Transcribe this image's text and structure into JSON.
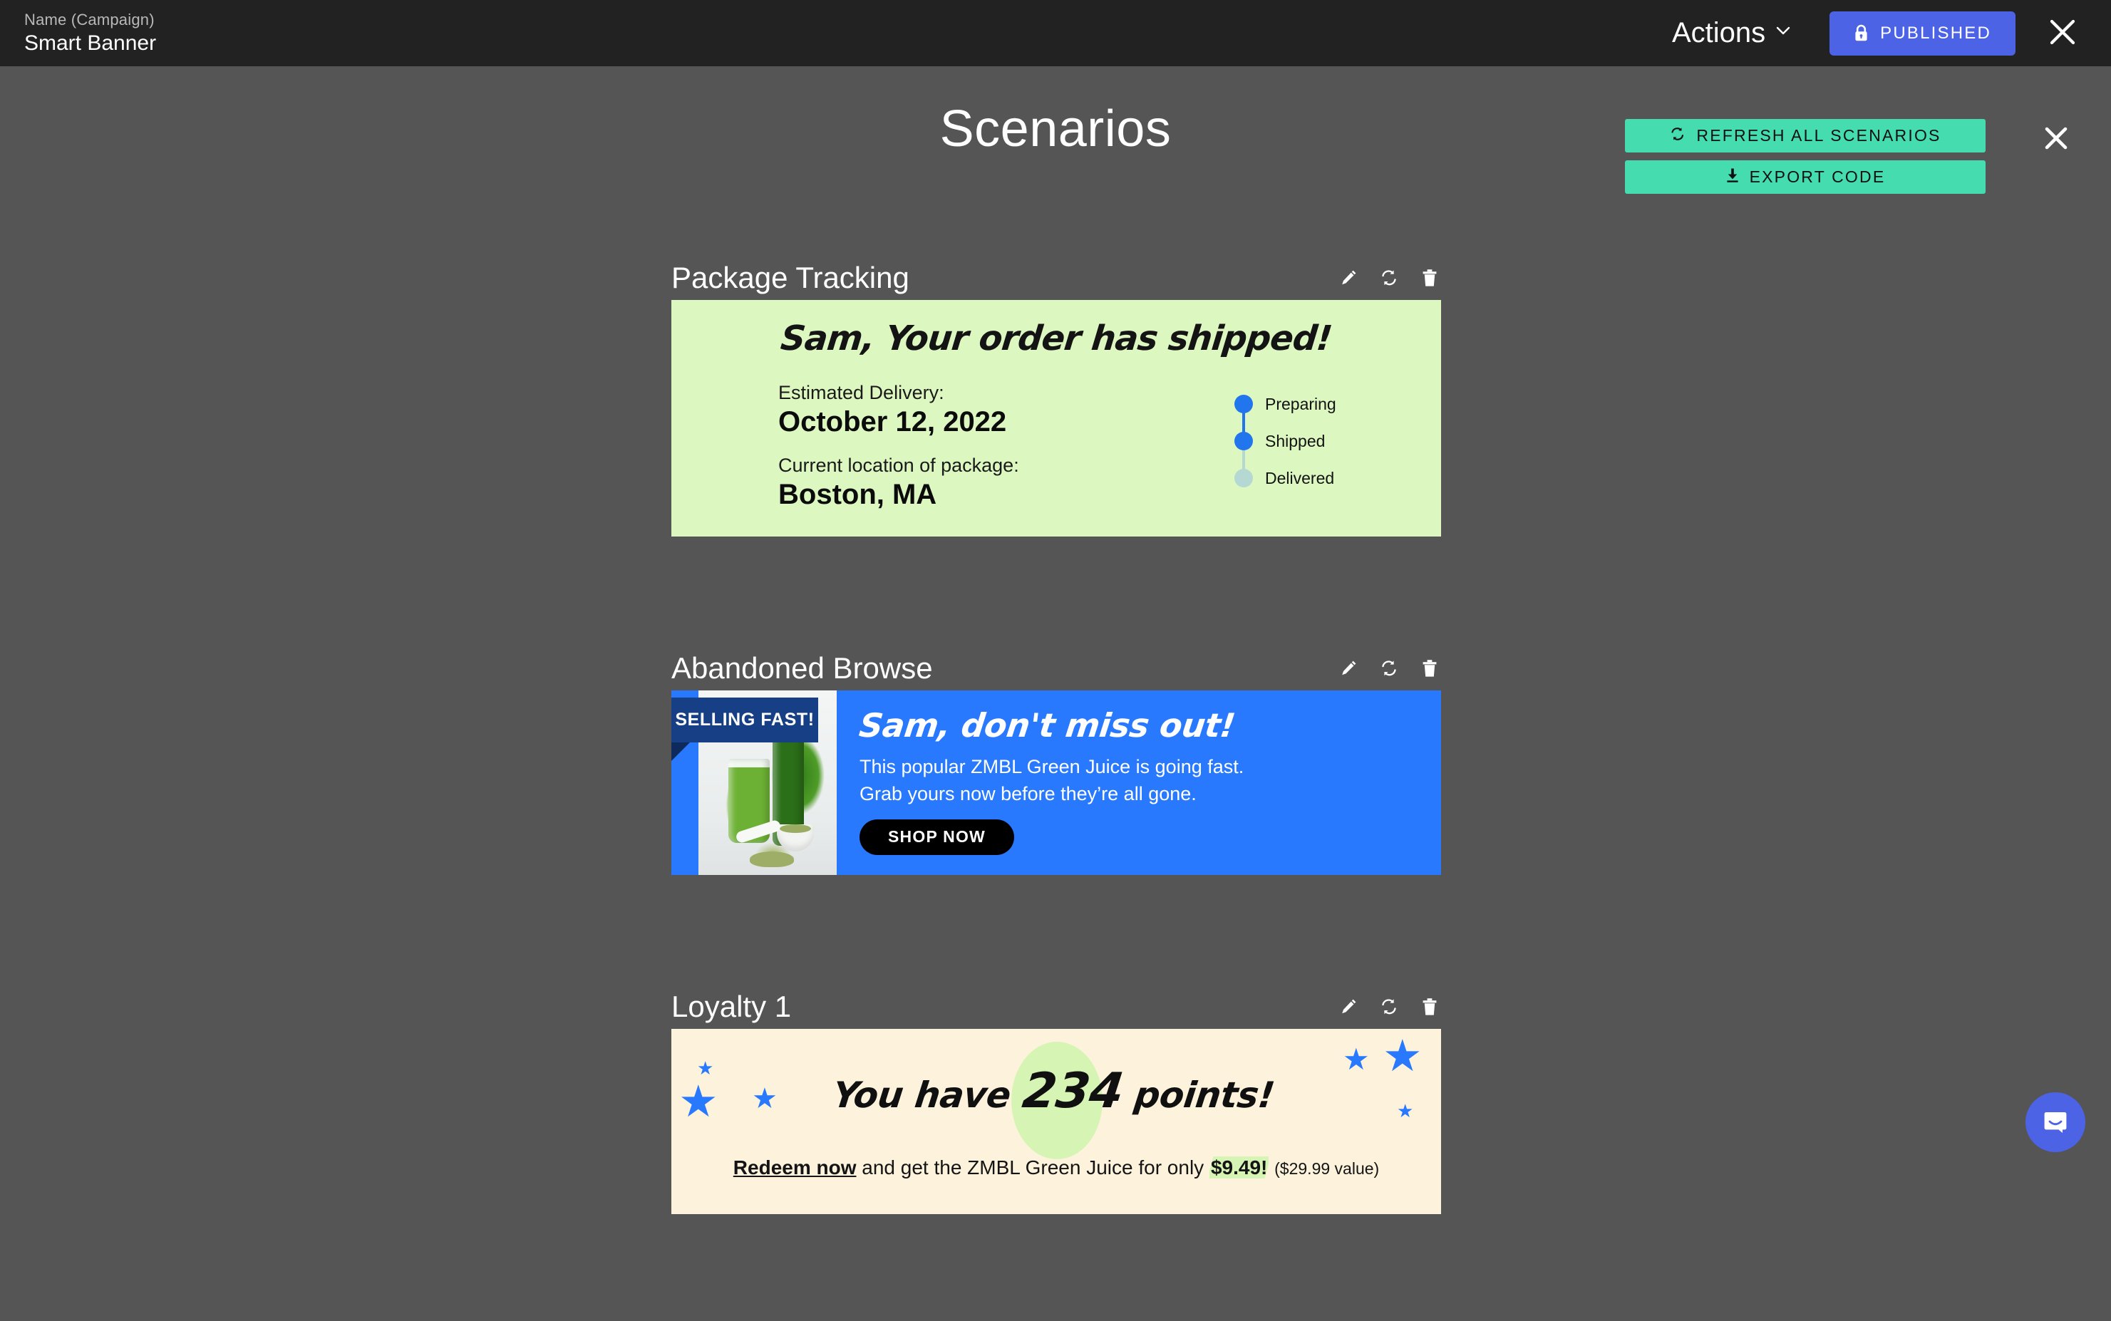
{
  "topbar": {
    "campaign_label": "Name (Campaign)",
    "campaign_name": "Smart Banner",
    "actions_label": "Actions",
    "published_label": "PUBLISHED",
    "close_label": "✕"
  },
  "header": {
    "title": "Scenarios",
    "refresh_all_label": "REFRESH ALL SCENARIOS",
    "export_code_label": "EXPORT CODE",
    "close_label": "✕"
  },
  "colors": {
    "page_bg": "#555555",
    "topbar_bg": "#222222",
    "accent_teal": "#45DCB0",
    "accent_blue": "#4C63E6",
    "brand_blue": "#2979FF",
    "ribbon_navy": "#163F86",
    "package_bg": "#DDF7C0",
    "loyalty_bg": "#FDF3DC",
    "loyalty_highlight": "#D6F5B4",
    "timeline_active": "#2176EE",
    "timeline_inactive": "#B5D8D3"
  },
  "scenarios": [
    {
      "name": "Package Tracking",
      "banner": {
        "headline": "Sam, Your order has shipped!",
        "fields": [
          {
            "label": "Estimated Delivery:",
            "value": "October 12, 2022"
          },
          {
            "label": "Current location of package:",
            "value": "Boston, MA"
          }
        ],
        "timeline": [
          {
            "label": "Preparing",
            "active": true
          },
          {
            "label": "Shipped",
            "active": true
          },
          {
            "label": "Delivered",
            "active": false
          }
        ]
      }
    },
    {
      "name": "Abandoned Browse",
      "banner": {
        "ribbon": "SELLING FAST!",
        "headline": "Sam, don't miss out!",
        "line1": "This popular ZMBL Green Juice is going fast.",
        "line2": "Grab yours now before they’re all gone.",
        "cta": "SHOP NOW"
      }
    },
    {
      "name": "Loyalty 1",
      "banner": {
        "headline_prefix": "You have ",
        "points": "234",
        "headline_suffix": " points!",
        "redeem": "Redeem now",
        "sub_mid": " and get the ZMBL Green Juice for only ",
        "price": "$9.49!",
        "value_note": "($29.99 value)"
      }
    }
  ],
  "icons": {
    "edit": "pencil-icon",
    "refresh": "refresh-icon",
    "delete": "trash-icon",
    "chat": "chat-bubble-icon"
  }
}
